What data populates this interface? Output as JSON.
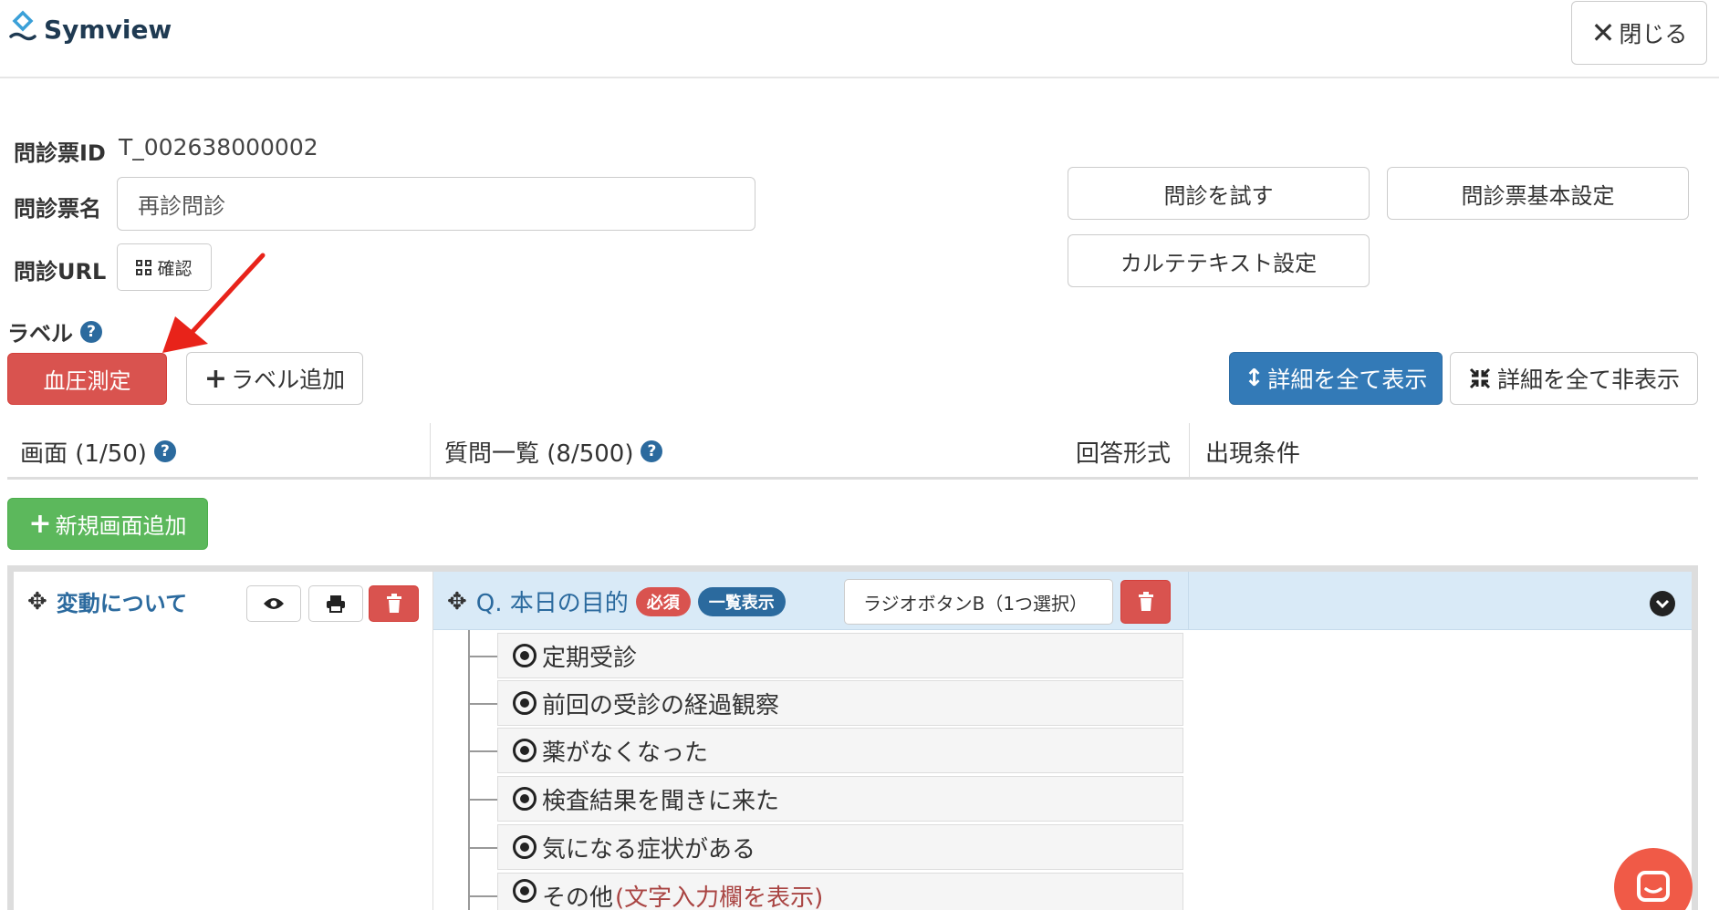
{
  "app": {
    "name": "Symview"
  },
  "header": {
    "close_label": "閉じる"
  },
  "form": {
    "id_label": "問診票ID",
    "id_value": "T_002638000002",
    "name_label": "問診票名",
    "name_value": "再診問診",
    "url_label": "問診URL",
    "url_button": "確認",
    "labels_heading": "ラベル"
  },
  "actions": {
    "try_interview": "問診を試す",
    "basic_settings": "問診票基本設定",
    "karte_text": "カルテテキスト設定"
  },
  "labels": {
    "items": [
      "血圧測定"
    ],
    "add_label": "ラベル追加"
  },
  "detail": {
    "show_all": "詳細を全て表示",
    "hide_all": "詳細を全て非表示"
  },
  "table": {
    "col_screens": "画面 (1/50)",
    "col_questions": "質問一覧 (8/500)",
    "col_answer_type": "回答形式",
    "col_conditions": "出現条件"
  },
  "add_screen": "新規画面追加",
  "screen": {
    "title": "変動について"
  },
  "question": {
    "title": "Q. 本日の目的",
    "required_badge": "必須",
    "list_badge": "一覧表示",
    "answer_type": "ラジオボタンB（1つ選択）",
    "options": [
      "定期受診",
      "前回の受診の経過観察",
      "薬がなくなった",
      "検査結果を聞きに来た",
      "気になる症状がある",
      "その他"
    ],
    "other_extra": "(文字入力欄を表示)"
  },
  "colors": {
    "primary_blue": "#337ab7",
    "danger_red": "#d9534f",
    "success_green": "#5cb85c",
    "question_row_bg": "#d9eaf7",
    "link_blue": "#2b6a9e",
    "chat_orange": "#f05a47"
  },
  "icons": [
    "symview-logo-icon",
    "close-x-icon",
    "qr-code-icon",
    "help-icon",
    "plus-icon",
    "arrows-vertical-icon",
    "compress-icon",
    "move-icon",
    "eye-icon",
    "print-icon",
    "trash-icon",
    "chevron-down-icon",
    "radio-selected-icon",
    "chat-icon"
  ]
}
